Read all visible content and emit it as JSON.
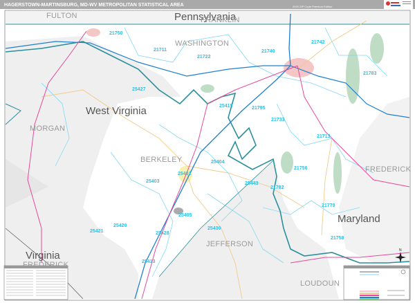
{
  "header": {
    "title": "HAGERSTOWN-MARTINSBURG, MD-WV METROPOLITAN STATISTICAL AREA",
    "edition": "2020 ZIP Code Premium Edition",
    "logo": "Market Maps"
  },
  "states": [
    "Pennsylvania",
    "West Virginia",
    "Maryland",
    "Virginia"
  ],
  "counties": [
    "FULTON",
    "FRANKLIN",
    "WASHINGTON",
    "MORGAN",
    "BERKELEY",
    "JEFFERSON",
    "FREDERICK",
    "LOUDOUN",
    "FREDERICK"
  ],
  "zips": [
    "21750",
    "21711",
    "21722",
    "21740",
    "21742",
    "21783",
    "25427",
    "25419",
    "21795",
    "21733",
    "21713",
    "25404",
    "25401",
    "25403",
    "21756",
    "25443",
    "21782",
    "21779",
    "25405",
    "25428",
    "25430",
    "25413",
    "21758",
    "25420",
    "25421"
  ],
  "compass": {
    "north": "N"
  },
  "colors": {
    "river": "#2a8f9c",
    "zip_boundary": "#7fd8f5",
    "interstate": "#1e7fd0",
    "us_highway": "#e8479b",
    "state_road": "#f2c98a",
    "wv_fill": "#efefef",
    "md_fill": "#ffffff",
    "park": "#bfdcc5",
    "urban": "#f5c6c6"
  }
}
